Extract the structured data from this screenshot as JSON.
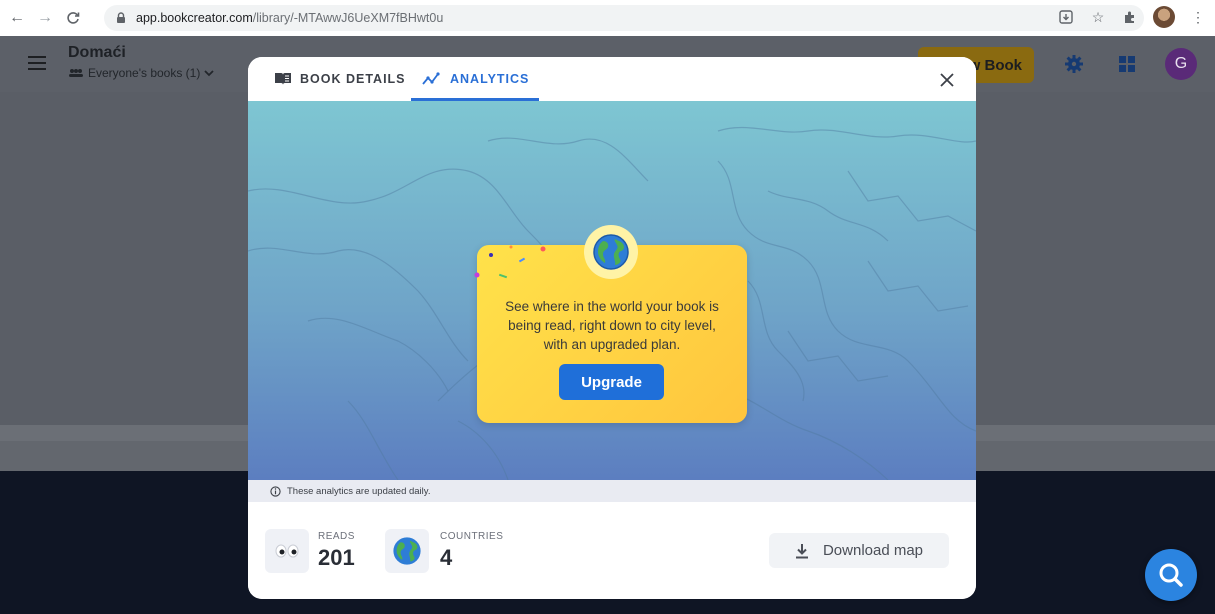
{
  "browser": {
    "url_host": "app.bookcreator.com",
    "url_path": "/library/-MTAwwJ6UeXM7fBHwt0u"
  },
  "app": {
    "library_title": "Domaći",
    "library_subtitle": "Everyone's books (1)",
    "new_book_label": "New Book",
    "avatar_initial": "G",
    "colors": {
      "accent": "#2a6fd6",
      "brand_yellow": "#ffc53d"
    }
  },
  "modal": {
    "tabs": [
      {
        "label": "BOOK DETAILS",
        "icon": "book-icon",
        "active": false
      },
      {
        "label": "ANALYTICS",
        "icon": "analytics-icon",
        "active": true
      }
    ],
    "promo": {
      "text": "See where in the world your book is being read, right down to city level, with an upgraded plan.",
      "button_label": "Upgrade"
    },
    "info_text": "These analytics are updated daily.",
    "stats": {
      "reads_label": "READS",
      "reads_value": "201",
      "countries_label": "COUNTRIES",
      "countries_value": "4"
    },
    "download_label": "Download map"
  }
}
